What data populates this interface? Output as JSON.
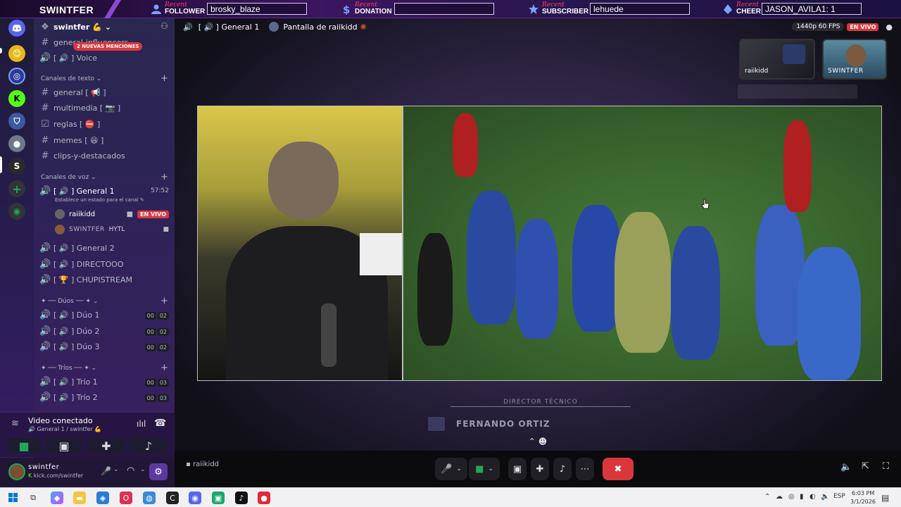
{
  "banner": {
    "brand": "SWINTFER",
    "recent_label": "Recent",
    "follower": {
      "type": "FOLLOWER",
      "value": "brosky_blaze"
    },
    "donation": {
      "type": "DONATION",
      "value": ""
    },
    "subscriber": {
      "type": "SUBSCRIBER",
      "value": "lehuede"
    },
    "cheer": {
      "type": "CHEER",
      "value": "JASON_AVILA1: 1"
    }
  },
  "server": {
    "name": "swintfer 💪",
    "mentions_badge": "2 NUEVAS MENCIONES",
    "top_channels": [
      {
        "icon": "#",
        "label": "general-influencers"
      },
      {
        "icon": "🔊",
        "label": "[ 🔊 ] Voice"
      }
    ],
    "text_category": "Canales de texto",
    "text_channels": [
      {
        "icon": "#",
        "label": "general [ 📢 ]"
      },
      {
        "icon": "#",
        "label": "multimedia [ 📷 ]"
      },
      {
        "icon": "☑",
        "label": "reglas [ ⛔ ]"
      },
      {
        "icon": "#",
        "label": "memes [ 😆 ]"
      },
      {
        "icon": "#",
        "label": "clips-y-destacados"
      }
    ],
    "voice_category": "Canales de voz",
    "active_voice": {
      "label": "[ 🔊 ] General 1",
      "timer": "57:52",
      "status_prompt": "Establece un estado para el canal",
      "members": [
        {
          "name": "raiikidd",
          "live": "EN VIVO"
        },
        {
          "name": "SWINTFER",
          "tag": "HYTL"
        }
      ]
    },
    "voice_channels": [
      {
        "label": "[ 🔊 ] General 2"
      },
      {
        "label": "[ 🔊 ] DIRECTOOO"
      },
      {
        "label": "[ 🏆 ] CHUPISTREAM"
      }
    ],
    "duos_category": "✦ ── Dúos ── ✦",
    "duos": [
      {
        "label": "[ 🔊 ] Dúo 1",
        "count": "00",
        "limit": "02"
      },
      {
        "label": "[ 🔊 ] Dúo 2",
        "count": "00",
        "limit": "02"
      },
      {
        "label": "[ 🔊 ] Dúo 3",
        "count": "00",
        "limit": "02"
      }
    ],
    "trios_category": "✦ ── Tríos ── ✦",
    "trios": [
      {
        "label": "[ 🔊 ] Trío 1",
        "count": "00",
        "limit": "03"
      },
      {
        "label": "[ 🔊 ] Trío 2",
        "count": "00",
        "limit": "03"
      }
    ]
  },
  "voice_panel": {
    "status": "Video conectado",
    "channel": "General 1 / swintfer 💪"
  },
  "user_panel": {
    "name": "swintfer",
    "subtitle": "kick.com/swintfer"
  },
  "stage": {
    "channel": "[ 🔊 ] General 1",
    "stream_title": "Pantalla de raiikidd",
    "quality": "1440p 60 FPS",
    "live": "EN VIVO",
    "thumbs": [
      {
        "name": "raiikidd"
      },
      {
        "name": "SWINTFER"
      }
    ],
    "lower_third_role": "DIRECTOR TÉCNICO",
    "lower_third_name": "FERNANDO ORTIZ",
    "text_channel_hint": "raiikidd"
  },
  "taskbar": {
    "lang": "ESP",
    "time": "6:03 PM",
    "date": "3/1/2026"
  },
  "colors": {
    "accent": "#5865f2",
    "live": "#da373c",
    "end_call": "#da373c",
    "video_green": "#23a55a",
    "banner_pink": "#ff3b6b"
  }
}
